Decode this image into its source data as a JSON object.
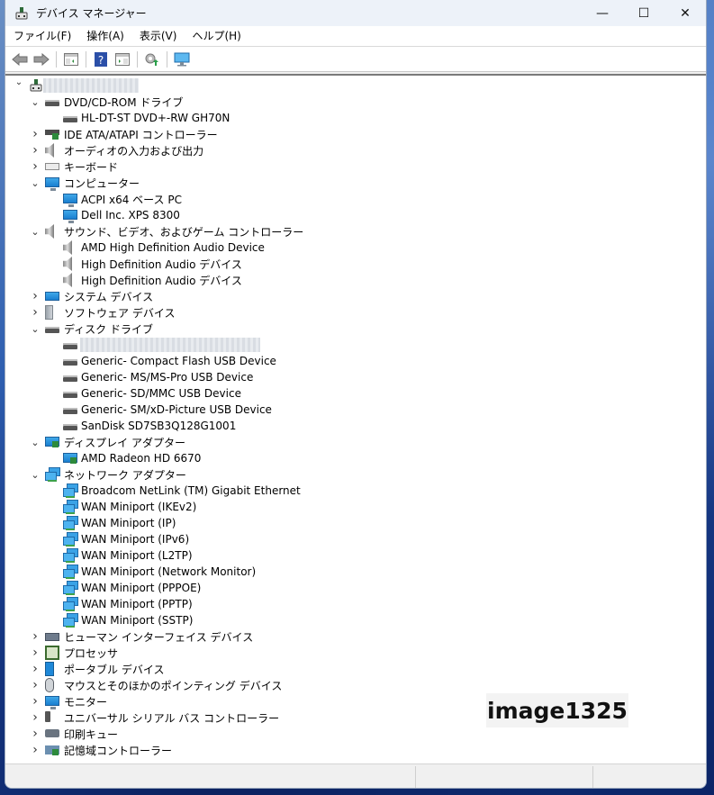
{
  "window": {
    "title": "デバイス マネージャー",
    "caption": {
      "minimize": "—",
      "maximize": "☐",
      "close": "✕"
    }
  },
  "menu": [
    "ファイル(F)",
    "操作(A)",
    "表示(V)",
    "ヘルプ(H)"
  ],
  "toolbar": [
    {
      "name": "back-button",
      "icon": "arrow-left-icon"
    },
    {
      "name": "forward-button",
      "icon": "arrow-right-icon"
    },
    {
      "name": "show-hide-console-tree-button",
      "icon": "console-tree-icon"
    },
    {
      "name": "help-button",
      "icon": "help-icon"
    },
    {
      "name": "show-action-pane-button",
      "icon": "action-pane-icon"
    },
    {
      "name": "update-driver-button",
      "icon": "update-driver-icon"
    },
    {
      "name": "scan-hardware-button",
      "icon": "scan-monitor-icon"
    }
  ],
  "tree": {
    "root": {
      "label": "",
      "redacted": true,
      "expanded": true
    },
    "categories": [
      {
        "label": "DVD/CD-ROM ドライブ",
        "icon": "dvd-drive-icon",
        "expanded": true,
        "children": [
          "HL-DT-ST DVD+-RW GH70N"
        ]
      },
      {
        "label": "IDE ATA/ATAPI コントローラー",
        "icon": "ide-controller-icon",
        "expanded": false,
        "children": []
      },
      {
        "label": "オーディオの入力および出力",
        "icon": "speaker-icon",
        "expanded": false,
        "children": []
      },
      {
        "label": "キーボード",
        "icon": "keyboard-icon",
        "expanded": false,
        "children": []
      },
      {
        "label": "コンピューター",
        "icon": "computer-icon",
        "expanded": true,
        "children": [
          "ACPI x64 ベース PC",
          "Dell Inc. XPS 8300"
        ]
      },
      {
        "label": "サウンド、ビデオ、およびゲーム コントローラー",
        "icon": "speaker-icon",
        "expanded": true,
        "children": [
          "AMD High Definition Audio Device",
          "High Definition Audio デバイス",
          "High Definition Audio デバイス"
        ]
      },
      {
        "label": "システム デバイス",
        "icon": "system-device-icon",
        "expanded": false,
        "children": []
      },
      {
        "label": "ソフトウェア デバイス",
        "icon": "software-device-icon",
        "expanded": false,
        "children": []
      },
      {
        "label": "ディスク ドライブ",
        "icon": "disk-drive-icon",
        "expanded": true,
        "children": [
          "",
          "Generic- Compact Flash USB Device",
          "Generic- MS/MS-Pro USB Device",
          "Generic- SD/MMC USB Device",
          "Generic- SM/xD-Picture USB Device",
          "SanDisk SD7SB3Q128G1001"
        ]
      },
      {
        "label": "ディスプレイ アダプター",
        "icon": "display-adapter-icon",
        "expanded": true,
        "children": [
          "AMD Radeon HD 6670"
        ]
      },
      {
        "label": "ネットワーク アダプター",
        "icon": "network-adapter-icon",
        "expanded": true,
        "children": [
          "Broadcom NetLink (TM) Gigabit Ethernet",
          "WAN Miniport (IKEv2)",
          "WAN Miniport (IP)",
          "WAN Miniport (IPv6)",
          "WAN Miniport (L2TP)",
          "WAN Miniport (Network Monitor)",
          "WAN Miniport (PPPOE)",
          "WAN Miniport (PPTP)",
          "WAN Miniport (SSTP)"
        ]
      },
      {
        "label": "ヒューマン インターフェイス デバイス",
        "icon": "hid-icon",
        "expanded": false,
        "children": []
      },
      {
        "label": "プロセッサ",
        "icon": "processor-icon",
        "expanded": false,
        "children": []
      },
      {
        "label": "ポータブル デバイス",
        "icon": "portable-device-icon",
        "expanded": false,
        "children": []
      },
      {
        "label": "マウスとそのほかのポインティング デバイス",
        "icon": "mouse-icon",
        "expanded": false,
        "children": []
      },
      {
        "label": "モニター",
        "icon": "monitor-icon",
        "expanded": false,
        "children": []
      },
      {
        "label": "ユニバーサル シリアル バス コントローラー",
        "icon": "usb-icon",
        "expanded": false,
        "children": []
      },
      {
        "label": "印刷キュー",
        "icon": "printer-icon",
        "expanded": false,
        "children": []
      },
      {
        "label": "記憶域コントローラー",
        "icon": "storage-controller-icon",
        "expanded": false,
        "children": []
      }
    ]
  },
  "watermark": "image1325"
}
